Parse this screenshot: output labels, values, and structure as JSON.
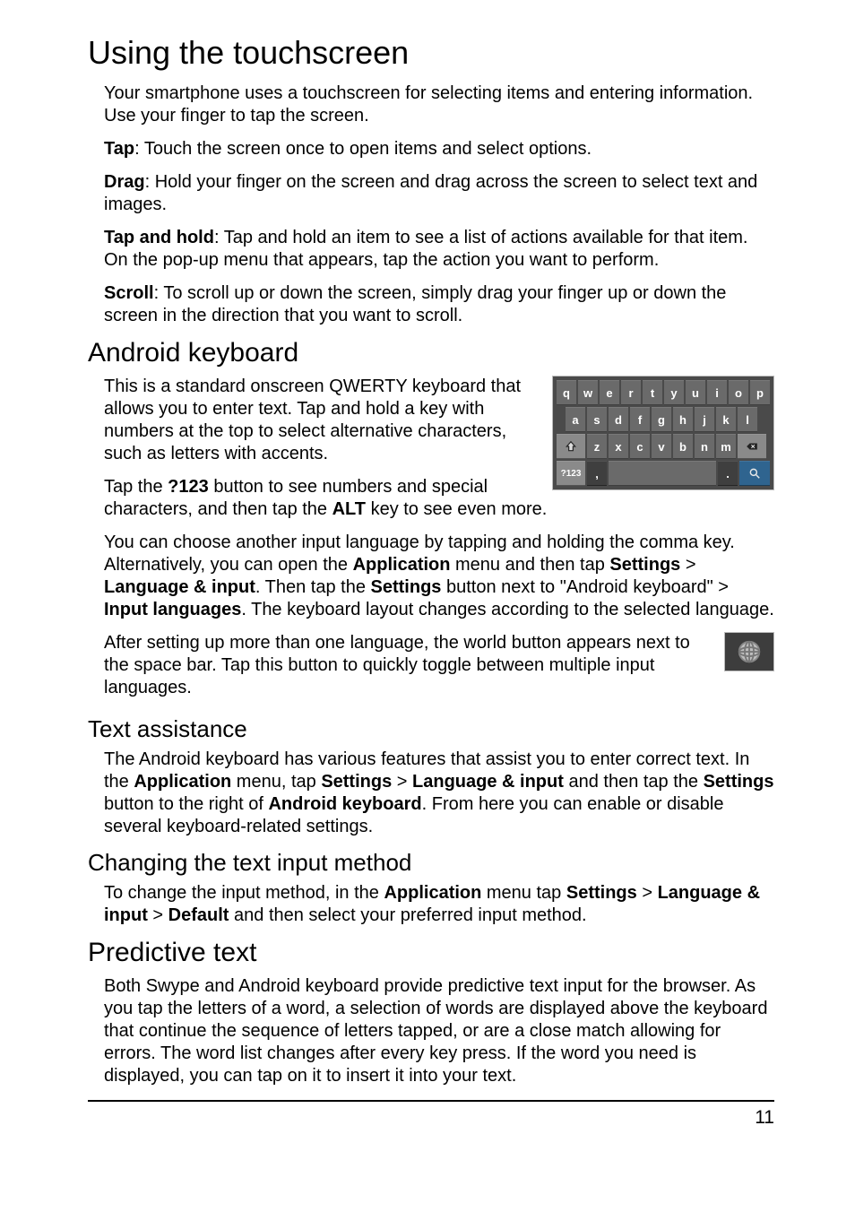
{
  "page": {
    "number": "11"
  },
  "h1": "Using the touchscreen",
  "intro": "Your smartphone uses a touchscreen for selecting items and entering information. Use your finger to tap the screen.",
  "tap": {
    "label": "Tap",
    "text": ": Touch the screen once to open items and select options."
  },
  "drag": {
    "label": "Drag",
    "text": ": Hold your finger on the screen and drag across the screen to select text and images."
  },
  "taphold": {
    "label": "Tap and hold",
    "text": ": Tap and hold an item to see a list of actions available for that item. On the pop-up menu that appears, tap the action you want to perform."
  },
  "scroll": {
    "label": "Scroll",
    "text": ": To scroll up or down the screen, simply drag your finger up or down the screen in the direction that you want to scroll."
  },
  "kb": {
    "heading": "Android keyboard",
    "p1": "This is a standard onscreen QWERTY keyboard that allows you to enter text. Tap and hold a key with numbers at the top to select alternative characters, such as letters with accents.",
    "p2a": "Tap the ",
    "p2_btn": "?123",
    "p2b": " button to see numbers and special characters, and then tap the ",
    "p2_alt": "ALT",
    "p2c": " key to see even more.",
    "p3a": "You can choose another input language by tapping and holding the comma key. Alternatively, you can open the ",
    "p3_app": "Application",
    "p3b": " menu and then tap ",
    "p3_settings": "Settings",
    "p3c": " > ",
    "p3_lang": "Language & input",
    "p3d": ". Then tap the ",
    "p3_settings2": "Settings",
    "p3e": " button next to \"Android keyboard\" > ",
    "p3_inputlang": "Input languages",
    "p3f": ". The keyboard layout changes according to the selected language.",
    "p4": "After setting up more than one language, the world button appears next to the space bar. Tap this button to quickly toggle between multiple input languages.",
    "keys": {
      "row1": [
        "q",
        "w",
        "e",
        "r",
        "t",
        "y",
        "u",
        "i",
        "o",
        "p"
      ],
      "row2": [
        "a",
        "s",
        "d",
        "f",
        "g",
        "h",
        "j",
        "k",
        "l"
      ],
      "row3": [
        "z",
        "x",
        "c",
        "v",
        "b",
        "n",
        "m"
      ],
      "row4": {
        "num": "?123",
        "comma": ",",
        "period": "."
      },
      "icons": {
        "shift": "shift-icon",
        "backspace": "backspace-icon",
        "search": "search-icon"
      }
    }
  },
  "ta": {
    "heading": "Text assistance",
    "p1a": "The Android keyboard has various features that assist you to enter correct text. In the ",
    "app": "Application",
    "p1b": " menu, tap ",
    "settings": "Settings",
    "p1c": " > ",
    "lang": "Language & input",
    "p1d": " and then tap the ",
    "settings2": "Settings",
    "p1e": " button to the right of ",
    "akbd": "Android keyboard",
    "p1f": ". From here you can enable or disable several keyboard-related settings."
  },
  "cm": {
    "heading": "Changing the text input method",
    "p1a": "To change the input method, in the ",
    "app": "Application",
    "p1b": " menu tap ",
    "settings": "Settings",
    "p1c": " > ",
    "lang": "Language & input",
    "p1d": " > ",
    "def": "Default",
    "p1e": " and then select your preferred input method."
  },
  "pt": {
    "heading": "Predictive text",
    "p1": "Both Swype and Android keyboard provide predictive text input for the browser. As you tap the letters of a word, a selection of words are displayed above the keyboard that continue the sequence of letters tapped, or are a close match allowing for errors. The word list changes after every key press. If the word you need is displayed, you can tap on it to insert it into your text."
  }
}
